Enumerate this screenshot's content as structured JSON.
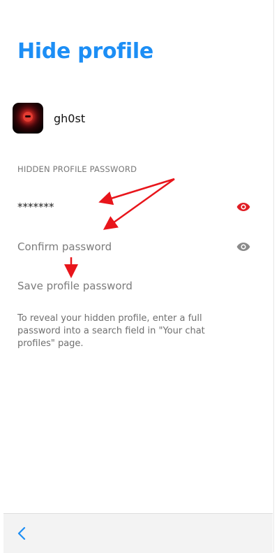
{
  "page": {
    "title": "Hide profile"
  },
  "profile": {
    "name": "gh0st"
  },
  "password_section": {
    "label": "HIDDEN PROFILE PASSWORD",
    "password_value": "*******",
    "confirm_placeholder": "Confirm password",
    "save_label": "Save profile password",
    "help_text": "To reveal your hidden profile, enter a full password into a search field in \"Your chat profiles\" page."
  },
  "icons": {
    "password_visibility": "eye-icon",
    "confirm_visibility": "eye-icon",
    "back": "chevron-left-icon"
  },
  "colors": {
    "title": "#1c8ef5",
    "eye_active": "#e01e25",
    "eye_inactive": "#8a8a8a",
    "annotation_arrow": "#e8151b",
    "back_chevron": "#1c8ef5"
  }
}
